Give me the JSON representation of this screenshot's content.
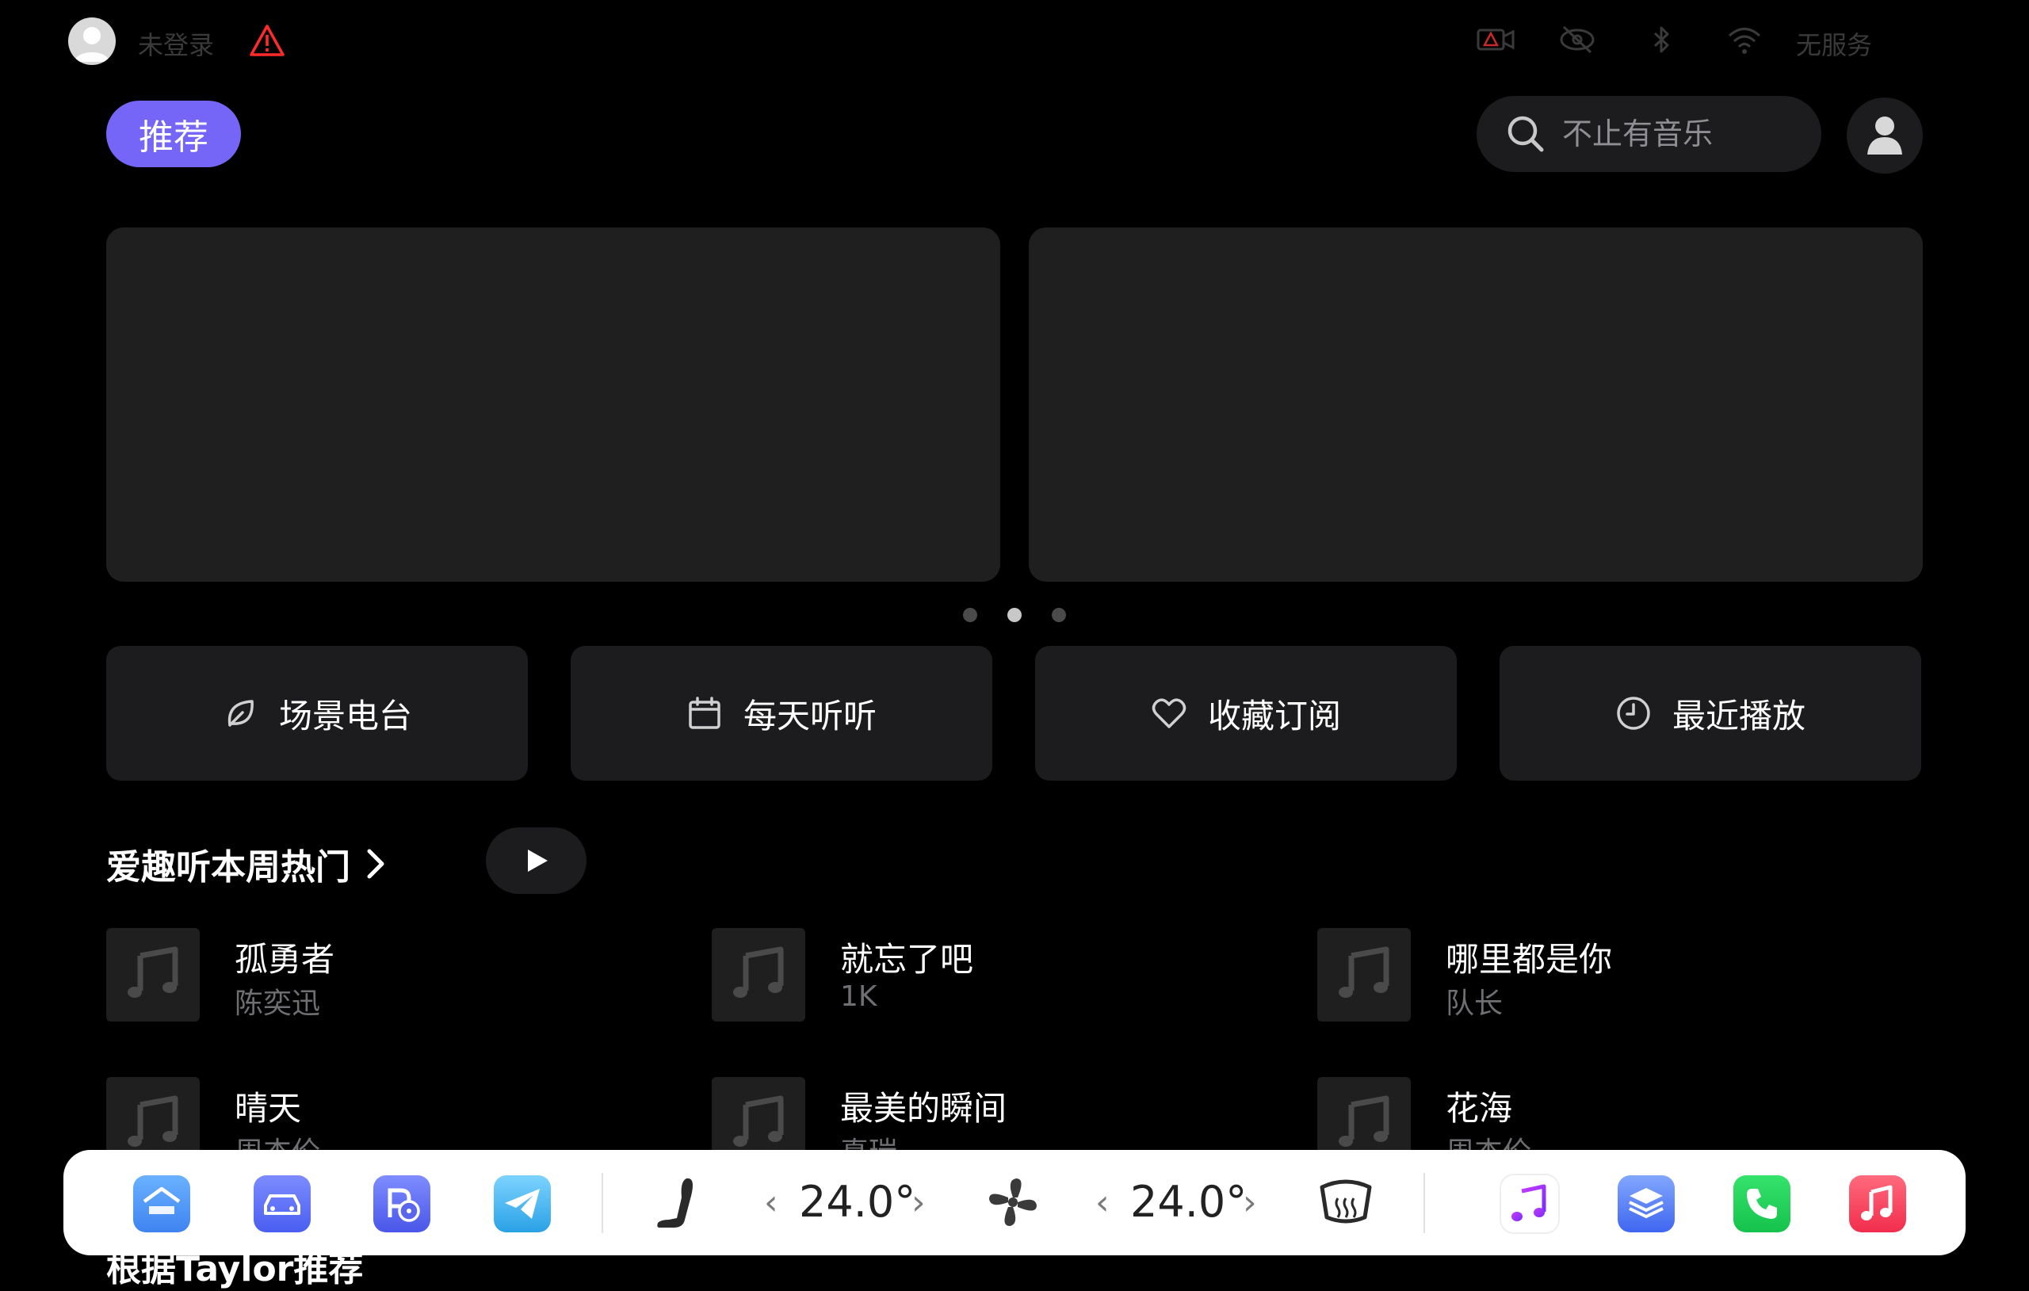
{
  "status_bar": {
    "login_text": "未登录",
    "alert_icon": "warning-triangle-icon",
    "icons": [
      "dashcam-alert-icon",
      "camera-off-icon",
      "bluetooth-icon",
      "wifi-icon"
    ],
    "network_text": "无服务"
  },
  "header": {
    "tab_label": "推荐",
    "search_placeholder": "不止有音乐",
    "profile_icon": "user-icon"
  },
  "carousel": {
    "page_count": 3,
    "active_index": 1
  },
  "quick_actions": [
    {
      "label": "场景电台",
      "icon": "leaf-icon"
    },
    {
      "label": "每天听听",
      "icon": "calendar-icon"
    },
    {
      "label": "收藏订阅",
      "icon": "heart-icon"
    },
    {
      "label": "最近播放",
      "icon": "clock-icon"
    }
  ],
  "hot_section": {
    "title": "爱趣听本周热门",
    "songs": [
      {
        "title": "孤勇者",
        "artist": "陈奕迅"
      },
      {
        "title": "就忘了吧",
        "artist": "1K"
      },
      {
        "title": "哪里都是你",
        "artist": "队长"
      },
      {
        "title": "晴天",
        "artist": "周杰伦"
      },
      {
        "title": "最美的瞬间",
        "artist": "真瑞"
      },
      {
        "title": "花海",
        "artist": "周杰伦"
      }
    ]
  },
  "next_section": {
    "title": "根据Taylor推荐"
  },
  "dock": {
    "left_apps": [
      "home-app-icon",
      "car-app-icon",
      "parking-app-icon",
      "telegram-app-icon"
    ],
    "seat_icon": "seat-heater-icon",
    "left_temp": "24.0°",
    "fan_icon": "fan-icon",
    "right_temp": "24.0°",
    "defrost_icon": "rear-defrost-icon",
    "right_apps": [
      "music-app-icon",
      "layers-app-icon",
      "phone-app-icon",
      "apple-music-app-icon"
    ],
    "colors": {
      "accent": "#7566f7",
      "phone": "#1fd35a",
      "music_red": "#fb3d5a"
    }
  }
}
